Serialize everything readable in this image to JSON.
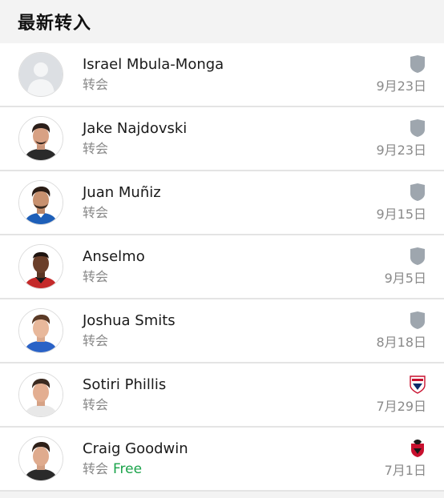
{
  "section": {
    "title": "最新转入"
  },
  "transfers": [
    {
      "name": "Israel Mbula-Monga",
      "type": "转会",
      "fee": "",
      "date": "9月23日",
      "club_icon": "generic-shield-icon",
      "avatar": "placeholder-avatar"
    },
    {
      "name": "Jake Najdovski",
      "type": "转会",
      "fee": "",
      "date": "9月23日",
      "club_icon": "generic-shield-icon",
      "avatar": "player-photo"
    },
    {
      "name": "Juan Muñiz",
      "type": "转会",
      "fee": "",
      "date": "9月15日",
      "club_icon": "generic-shield-icon",
      "avatar": "player-photo"
    },
    {
      "name": "Anselmo",
      "type": "转会",
      "fee": "",
      "date": "9月5日",
      "club_icon": "generic-shield-icon",
      "avatar": "player-photo"
    },
    {
      "name": "Joshua Smits",
      "type": "转会",
      "fee": "",
      "date": "8月18日",
      "club_icon": "generic-shield-icon",
      "avatar": "player-photo"
    },
    {
      "name": "Sotiri Phillis",
      "type": "转会",
      "fee": "",
      "date": "7月29日",
      "club_icon": "adelaide-united-crest-icon",
      "avatar": "player-photo"
    },
    {
      "name": "Craig Goodwin",
      "type": "转会",
      "fee": "Free",
      "date": "7月1日",
      "club_icon": "al-wehda-crest-icon",
      "avatar": "player-photo"
    }
  ],
  "colors": {
    "background": "#f3f3f3",
    "fee_free": "#1aa34a",
    "muted_text": "#888888",
    "shield_gray": "#9ea6ae"
  }
}
